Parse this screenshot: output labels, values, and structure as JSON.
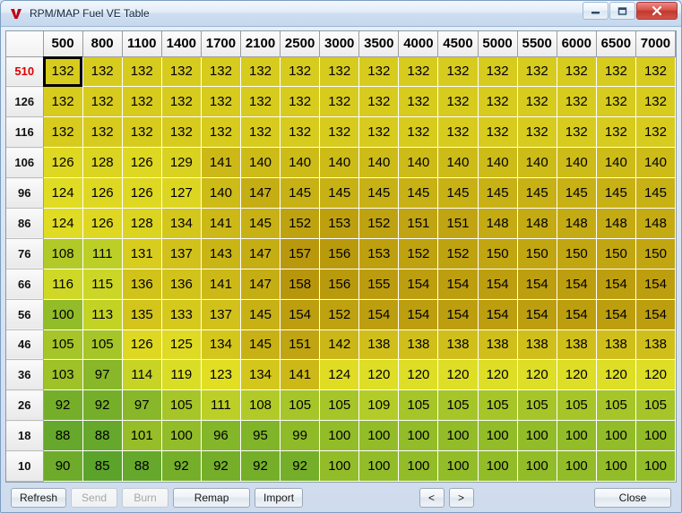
{
  "window": {
    "title": "RPM/MAP Fuel VE Table",
    "icon": "v-logo-icon",
    "minimize_label": "–",
    "maximize_label": "□",
    "close_label": "✕"
  },
  "table": {
    "corner_label": "",
    "columns": [
      "500",
      "800",
      "1100",
      "1400",
      "1700",
      "2100",
      "2500",
      "3000",
      "3500",
      "4000",
      "4500",
      "5000",
      "5500",
      "6000",
      "6500",
      "7000"
    ],
    "rows": [
      "510",
      "126",
      "116",
      "106",
      "96",
      "86",
      "76",
      "66",
      "56",
      "46",
      "36",
      "26",
      "18",
      "10"
    ],
    "highlight_row_index": 0,
    "selected_cell": {
      "row": 0,
      "col": 0
    },
    "values": [
      [
        132,
        132,
        132,
        132,
        132,
        132,
        132,
        132,
        132,
        132,
        132,
        132,
        132,
        132,
        132,
        132
      ],
      [
        132,
        132,
        132,
        132,
        132,
        132,
        132,
        132,
        132,
        132,
        132,
        132,
        132,
        132,
        132,
        132
      ],
      [
        132,
        132,
        132,
        132,
        132,
        132,
        132,
        132,
        132,
        132,
        132,
        132,
        132,
        132,
        132,
        132
      ],
      [
        126,
        128,
        126,
        129,
        141,
        140,
        140,
        140,
        140,
        140,
        140,
        140,
        140,
        140,
        140,
        140
      ],
      [
        124,
        126,
        126,
        127,
        140,
        147,
        145,
        145,
        145,
        145,
        145,
        145,
        145,
        145,
        145,
        145
      ],
      [
        124,
        126,
        128,
        134,
        141,
        145,
        152,
        153,
        152,
        151,
        151,
        148,
        148,
        148,
        148,
        148
      ],
      [
        108,
        111,
        131,
        137,
        143,
        147,
        157,
        156,
        153,
        152,
        152,
        150,
        150,
        150,
        150,
        150
      ],
      [
        116,
        115,
        136,
        136,
        141,
        147,
        158,
        156,
        155,
        154,
        154,
        154,
        154,
        154,
        154,
        154
      ],
      [
        100,
        113,
        135,
        133,
        137,
        145,
        154,
        152,
        154,
        154,
        154,
        154,
        154,
        154,
        154,
        154
      ],
      [
        105,
        105,
        126,
        125,
        134,
        145,
        151,
        142,
        138,
        138,
        138,
        138,
        138,
        138,
        138,
        138
      ],
      [
        103,
        97,
        114,
        119,
        123,
        134,
        141,
        124,
        120,
        120,
        120,
        120,
        120,
        120,
        120,
        120
      ],
      [
        92,
        92,
        97,
        105,
        111,
        108,
        105,
        105,
        109,
        105,
        105,
        105,
        105,
        105,
        105,
        105
      ],
      [
        88,
        88,
        101,
        100,
        96,
        95,
        99,
        100,
        100,
        100,
        100,
        100,
        100,
        100,
        100,
        100
      ],
      [
        90,
        85,
        88,
        92,
        92,
        92,
        92,
        100,
        100,
        100,
        100,
        100,
        100,
        100,
        100,
        100
      ]
    ],
    "color_scale": {
      "min_value": 85,
      "max_value": 158,
      "low_color": "#5ba32b",
      "mid_color": "#e3e125",
      "high_color": "#b8960c"
    }
  },
  "toolbar": {
    "refresh_label": "Refresh",
    "send_label": "Send",
    "send_enabled": false,
    "burn_label": "Burn",
    "burn_enabled": false,
    "remap_label": "Remap",
    "import_label": "Import",
    "prev_label": "<",
    "next_label": ">",
    "close_label": "Close"
  }
}
